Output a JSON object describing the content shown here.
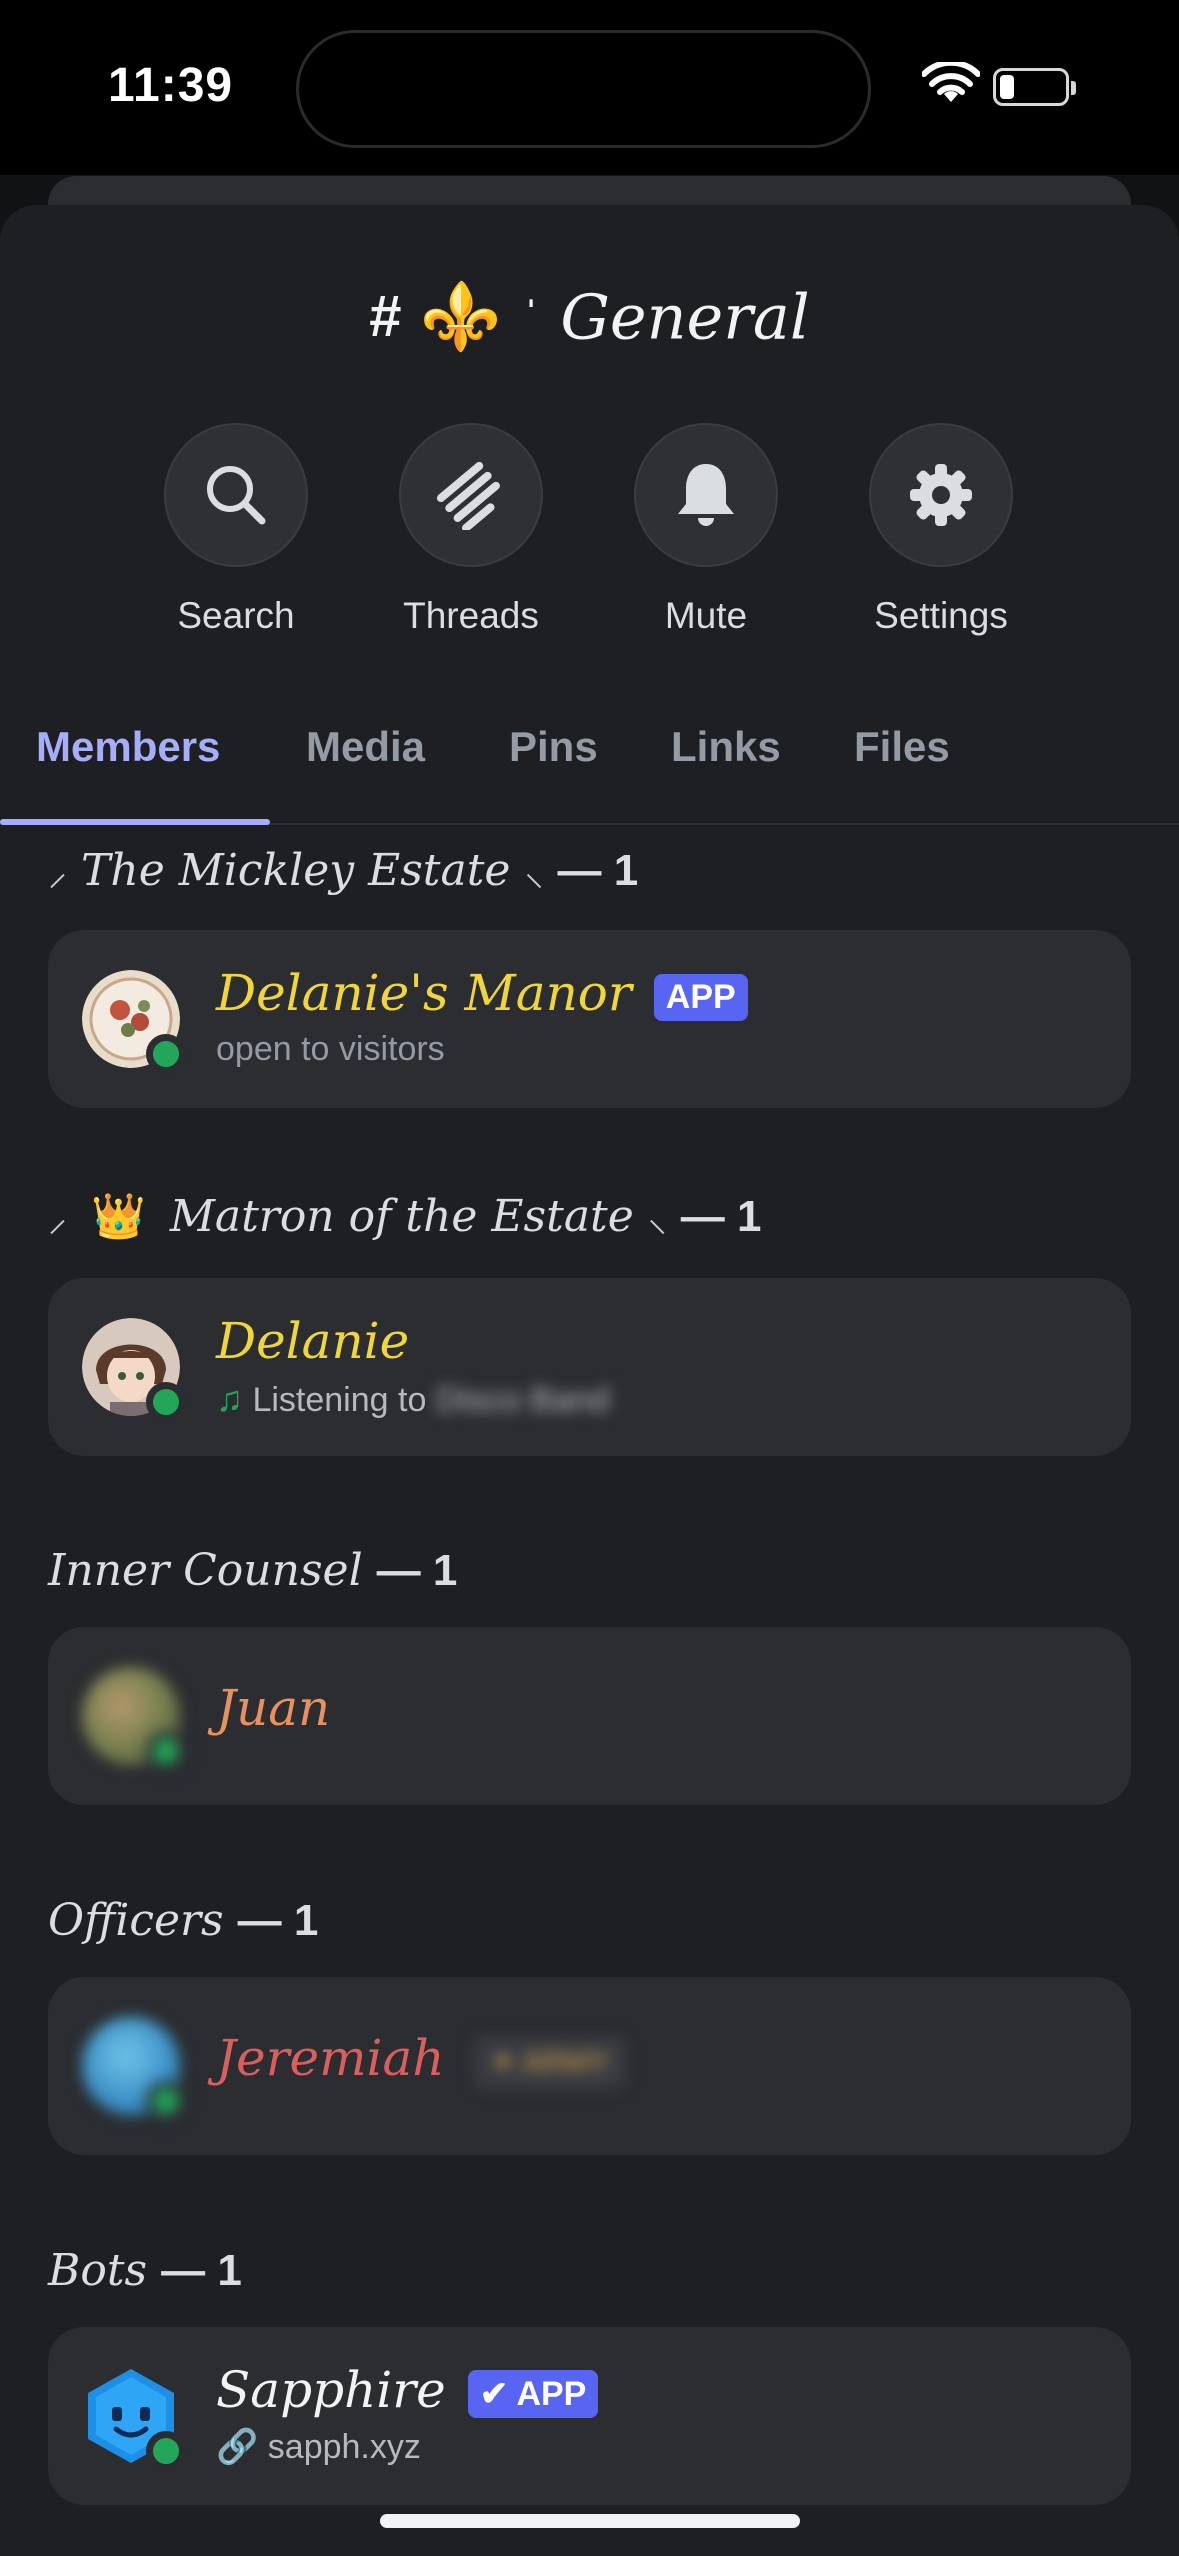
{
  "status_bar": {
    "time": "11:39"
  },
  "channel": {
    "hash": "#",
    "emoji": "⚜️",
    "separator": "ˈ",
    "name": "General"
  },
  "actions": [
    {
      "label": "Search",
      "icon": "search-icon"
    },
    {
      "label": "Threads",
      "icon": "threads-icon"
    },
    {
      "label": "Mute",
      "icon": "bell-icon"
    },
    {
      "label": "Settings",
      "icon": "gear-icon"
    }
  ],
  "tabs": [
    {
      "label": "Members",
      "active": true
    },
    {
      "label": "Media",
      "active": false
    },
    {
      "label": "Pins",
      "active": false
    },
    {
      "label": "Links",
      "active": false
    },
    {
      "label": "Files",
      "active": false
    }
  ],
  "sections": {
    "estate": {
      "title": "The Mickley Estate",
      "count": "— 1"
    },
    "matron": {
      "title": "Matron of the Estate",
      "count": "— 1"
    },
    "counsel": {
      "title": "Inner Counsel",
      "count": "— 1"
    },
    "officers": {
      "title": "Officers",
      "count": "— 1"
    },
    "bots": {
      "title": "Bots",
      "count": "— 1"
    }
  },
  "members": {
    "manor": {
      "name": "Delanie's Manor",
      "badge": "APP",
      "subtitle": "open to visitors",
      "color": "#f0d63c"
    },
    "delanie": {
      "name": "Delanie",
      "activity_prefix": "Listening to",
      "activity_value": "Disco Band",
      "color": "#f0d63c"
    },
    "juan": {
      "name": "Juan",
      "color": "#e8905f"
    },
    "jeremiah": {
      "name": "Jeremiah",
      "tag": "✦ ARMY",
      "color": "#d95e5e"
    },
    "sapphire": {
      "name": "Sapphire",
      "badge": "APP",
      "link": "sapph.xyz",
      "color": "#f2f3f5"
    }
  },
  "colors": {
    "accent": "#a6adfa",
    "online": "#23a55a",
    "app_badge": "#5865f2",
    "fleur": "#d9a62e"
  }
}
